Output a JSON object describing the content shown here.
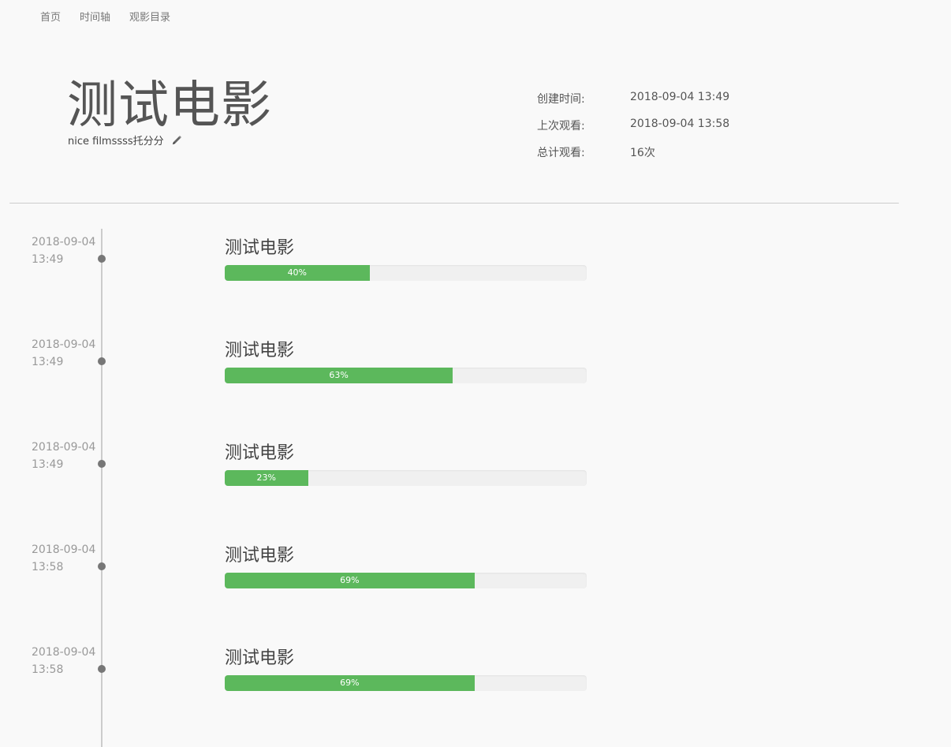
{
  "nav": {
    "items": [
      "首页",
      "时间轴",
      "观影目录"
    ]
  },
  "hero": {
    "title": "测试电影",
    "description": "nice filmssss托分分",
    "edit_icon": "pencil-icon"
  },
  "meta": {
    "rows": [
      {
        "key": "创建时间:",
        "value": "2018-09-04 13:49"
      },
      {
        "key": "上次观看:",
        "value": "2018-09-04 13:58"
      },
      {
        "key": "总计观看:",
        "value": "16次"
      }
    ]
  },
  "colors": {
    "progress_fill": "#5cb85c",
    "progress_track": "#f0f0f0",
    "timeline": "#cccccc"
  },
  "timeline": {
    "entries": [
      {
        "date": "2018-09-04",
        "time": "13:49",
        "title": "测试电影",
        "progress": 40,
        "progress_label": "40%"
      },
      {
        "date": "2018-09-04",
        "time": "13:49",
        "title": "测试电影",
        "progress": 63,
        "progress_label": "63%"
      },
      {
        "date": "2018-09-04",
        "time": "13:49",
        "title": "测试电影",
        "progress": 23,
        "progress_label": "23%"
      },
      {
        "date": "2018-09-04",
        "time": "13:58",
        "title": "测试电影",
        "progress": 69,
        "progress_label": "69%"
      },
      {
        "date": "2018-09-04",
        "time": "13:58",
        "title": "测试电影",
        "progress": 69,
        "progress_label": "69%"
      }
    ]
  }
}
